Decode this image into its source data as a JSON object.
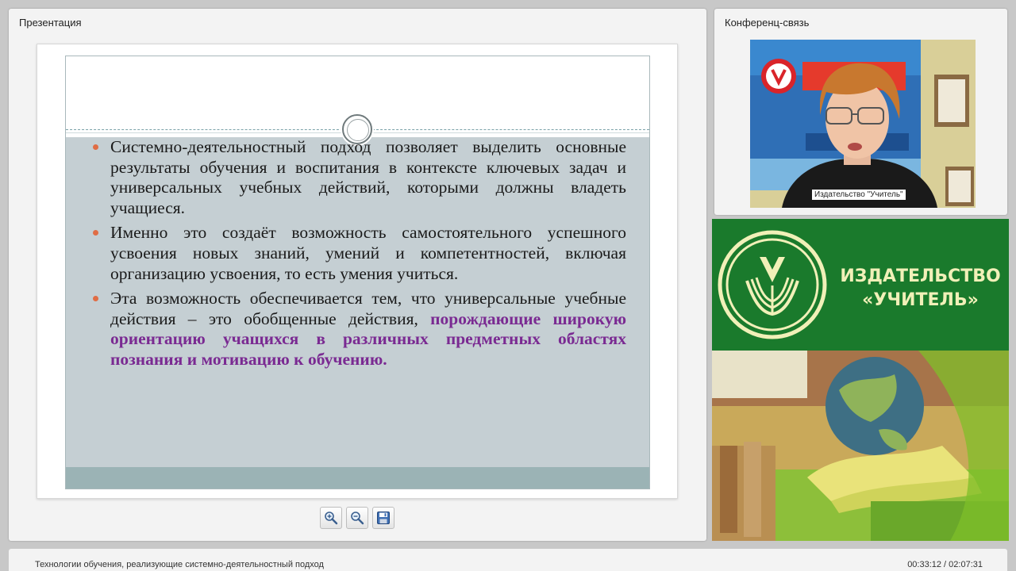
{
  "presentation": {
    "title": "Презентация",
    "bullets": [
      {
        "text": "Системно-деятельностный подход позволяет выделить основные результаты обучения и воспитания в контексте ключевых задач и универсальных учебных действий, которыми должны владеть учащиеся."
      },
      {
        "text": " Именно это создаёт возможность самостоятельного успешного усвоения новых знаний, умений и компетентностей, включая организацию усвоения, то есть умения учиться."
      },
      {
        "text": "Эта возможность обеспечивается тем, что универсальные учебные действия – это обобщенные действия, ",
        "highlight": "порождающие широкую ориентацию учащихся в различных предметных областях познания и мотивацию к обучению."
      }
    ],
    "bullet_color": "#e06d45",
    "highlight_color": "#7a2a92",
    "toolbar": {
      "zoom_in_icon": "zoom-in-icon",
      "zoom_out_icon": "zoom-out-icon",
      "save_icon": "floppy-disk-icon"
    }
  },
  "conference": {
    "title": "Конференц-связь",
    "speaker_label": "Издательство \"Учитель\""
  },
  "publisher": {
    "name_line1": "ИЗДАТЕЛЬСТВО",
    "name_line2": "«УЧИТЕЛЬ»",
    "brand_green": "#1a7a2c",
    "brand_text_color": "#f1f0b8"
  },
  "footer": {
    "course_title": "Технологии обучения, реализующие системно-деятельностный подход",
    "time": "00:33:12 / 02:07:31"
  }
}
